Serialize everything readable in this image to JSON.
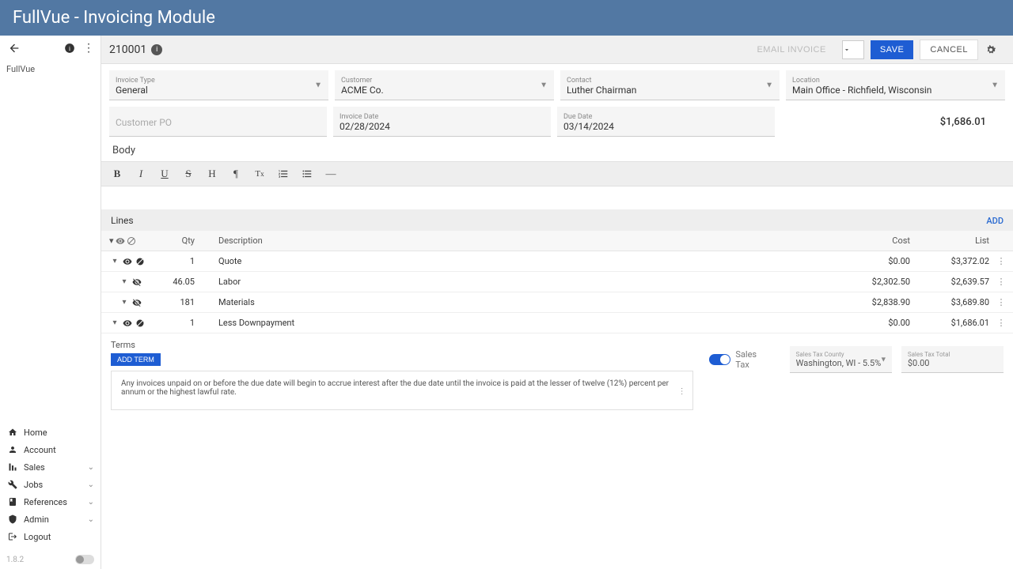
{
  "title": "FullVue - Invoicing Module",
  "breadcrumb": "FullVue",
  "invoice_number": "210001",
  "toolbar": {
    "email": "EMAIL INVOICE",
    "save": "SAVE",
    "cancel": "CANCEL"
  },
  "fields": {
    "invoice_type": {
      "label": "Invoice Type",
      "value": "General"
    },
    "customer": {
      "label": "Customer",
      "value": "ACME Co."
    },
    "contact": {
      "label": "Contact",
      "value": "Luther Chairman"
    },
    "location": {
      "label": "Location",
      "value": "Main Office - Richfield, Wisconsin"
    },
    "customer_po": {
      "label": "Customer PO",
      "value": ""
    },
    "invoice_date": {
      "label": "Invoice Date",
      "value": "02/28/2024"
    },
    "due_date": {
      "label": "Due Date",
      "value": "03/14/2024"
    },
    "total": "$1,686.01"
  },
  "body_title": "Body",
  "lines": {
    "title": "Lines",
    "add": "ADD",
    "cols": {
      "qty": "Qty",
      "desc": "Description",
      "cost": "Cost",
      "list": "List"
    },
    "rows": [
      {
        "indent": 0,
        "qty": "1",
        "desc": "Quote",
        "cost": "$0.00",
        "list": "$3,372.02",
        "visible": true
      },
      {
        "indent": 1,
        "qty": "46.05",
        "desc": "Labor",
        "cost": "$2,302.50",
        "list": "$2,639.57",
        "visible": false
      },
      {
        "indent": 1,
        "qty": "181",
        "desc": "Materials",
        "cost": "$2,838.90",
        "list": "$3,689.80",
        "visible": false
      },
      {
        "indent": 0,
        "qty": "1",
        "desc": "Less Downpayment",
        "cost": "$0.00",
        "list": "$1,686.01",
        "visible": true
      }
    ]
  },
  "terms": {
    "title": "Terms",
    "add": "ADD TERM",
    "text": "Any invoices unpaid on or before the due date will begin to accrue interest after the due date until the invoice is paid at the lesser of twelve (12%) percent per annum or the highest lawful rate."
  },
  "tax": {
    "label": "Sales Tax",
    "county_label": "Sales Tax County",
    "county_value": "Washington, WI - 5.5%",
    "total_label": "Sales Tax Total",
    "total_value": "$0.00"
  },
  "nav": [
    {
      "label": "Home",
      "icon": "home",
      "expandable": false
    },
    {
      "label": "Account",
      "icon": "person",
      "expandable": false
    },
    {
      "label": "Sales",
      "icon": "sales",
      "expandable": true
    },
    {
      "label": "Jobs",
      "icon": "wrench",
      "expandable": true
    },
    {
      "label": "References",
      "icon": "book",
      "expandable": true
    },
    {
      "label": "Admin",
      "icon": "admin",
      "expandable": true
    },
    {
      "label": "Logout",
      "icon": "logout",
      "expandable": false
    }
  ],
  "version": "1.8.2"
}
